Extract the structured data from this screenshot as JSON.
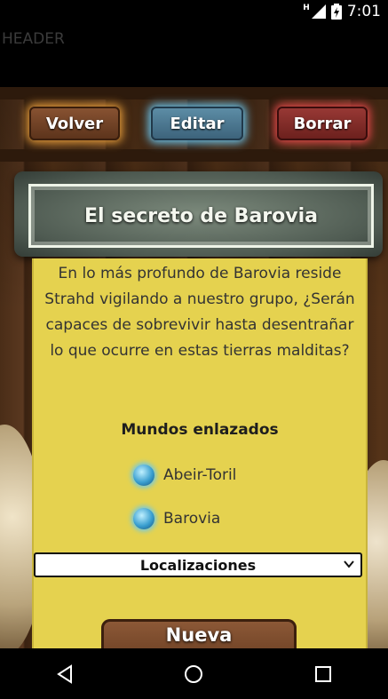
{
  "status_bar": {
    "time": "7:01",
    "network_label": "H"
  },
  "header": {
    "text": "HEADER"
  },
  "actions": {
    "back_label": "Volver",
    "edit_label": "Editar",
    "delete_label": "Borrar"
  },
  "campaign": {
    "title": "El secreto de Barovia",
    "description": "En lo más profundo de Barovia reside Strahd vigilando a nuestro grupo, ¿Serán capaces de sobrevivir hasta desentrañar lo que ocurre en estas tierras malditas?"
  },
  "linked_worlds": {
    "title": "Mundos enlazados",
    "items": [
      {
        "name": "Abeir-Toril",
        "icon": "blue-gem-icon"
      },
      {
        "name": "Barovia",
        "icon": "blue-gem-icon"
      }
    ]
  },
  "locations_select": {
    "selected": "Localizaciones"
  },
  "new_button": {
    "label": "Nueva"
  },
  "colors": {
    "panel": "#e5d24f",
    "back_glow": "#e39a3a",
    "edit_glow": "#6cc3ea",
    "delete_glow": "#e24a4a"
  }
}
